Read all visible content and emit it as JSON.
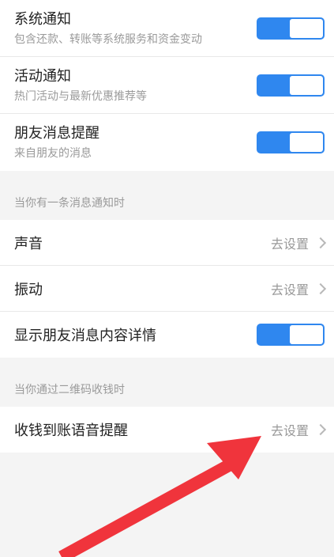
{
  "notifications": [
    {
      "title": "系统通知",
      "subtitle": "包含还款、转账等系统服务和资金变动",
      "enabled": true
    },
    {
      "title": "活动通知",
      "subtitle": "热门活动与最新优惠推荐等",
      "enabled": true
    },
    {
      "title": "朋友消息提醒",
      "subtitle": "来自朋友的消息",
      "enabled": true
    }
  ],
  "section_message": {
    "header": "当你有一条消息通知时",
    "sound": {
      "title": "声音",
      "action": "去设置"
    },
    "vibration": {
      "title": "振动",
      "action": "去设置"
    },
    "show_details": {
      "title": "显示朋友消息内容详情",
      "enabled": true
    }
  },
  "section_qr": {
    "header": "当你通过二维码收钱时",
    "voice": {
      "title": "收钱到账语音提醒",
      "action": "去设置"
    }
  },
  "colors": {
    "toggle_on": "#2f87ef",
    "annotation_arrow": "#f0343c"
  },
  "icons": {
    "chevron": "chevron-right-icon"
  }
}
